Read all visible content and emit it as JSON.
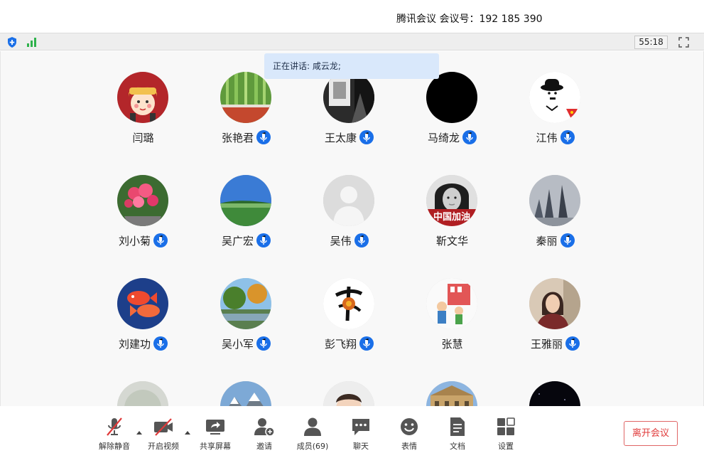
{
  "window": {
    "title": "腾讯会议 会议号：192 185 390"
  },
  "infobar": {
    "timer": "55:18"
  },
  "speaking": {
    "text": "正在讲话: 咸云龙;"
  },
  "participants": [
    {
      "name": "闫璐",
      "mic": false,
      "avatar": "cartoon-girl"
    },
    {
      "name": "张艳君",
      "mic": true,
      "avatar": "bamboo"
    },
    {
      "name": "王太康",
      "mic": true,
      "avatar": "dark-photo"
    },
    {
      "name": "马绮龙",
      "mic": true,
      "avatar": "black"
    },
    {
      "name": "江伟",
      "mic": true,
      "avatar": "chaplin"
    },
    {
      "name": "刘小菊",
      "mic": true,
      "avatar": "flowers"
    },
    {
      "name": "吴广宏",
      "mic": true,
      "avatar": "landscape"
    },
    {
      "name": "吴伟",
      "mic": true,
      "avatar": "default"
    },
    {
      "name": "靳文华",
      "mic": false,
      "avatar": "portrait-china",
      "avatar_caption": "中国加油"
    },
    {
      "name": "秦丽",
      "mic": true,
      "avatar": "shadows"
    },
    {
      "name": "刘建功",
      "mic": true,
      "avatar": "fish"
    },
    {
      "name": "吴小军",
      "mic": true,
      "avatar": "park"
    },
    {
      "name": "彭飞翔",
      "mic": true,
      "avatar": "calligraphy"
    },
    {
      "name": "张慧",
      "mic": false,
      "avatar": "illustration"
    },
    {
      "name": "王雅丽",
      "mic": true,
      "avatar": "woman"
    },
    {
      "name": "",
      "mic": false,
      "avatar": "fog"
    },
    {
      "name": "",
      "mic": false,
      "avatar": "mountain"
    },
    {
      "name": "",
      "mic": false,
      "avatar": "baby"
    },
    {
      "name": "",
      "mic": false,
      "avatar": "building"
    },
    {
      "name": "",
      "mic": false,
      "avatar": "night"
    }
  ],
  "toolbar": {
    "unmute": "解除静音",
    "start_video": "开启视频",
    "share_screen": "共享屏幕",
    "invite": "邀请",
    "members": "成员(69)",
    "chat": "聊天",
    "reactions": "表情",
    "docs": "文档",
    "settings": "设置",
    "leave": "离开会议"
  },
  "colors": {
    "accent": "#1a6fe8",
    "leave": "#e03a3a",
    "speaking_bg": "#d9e8fb",
    "signal": "#2fb24c"
  }
}
